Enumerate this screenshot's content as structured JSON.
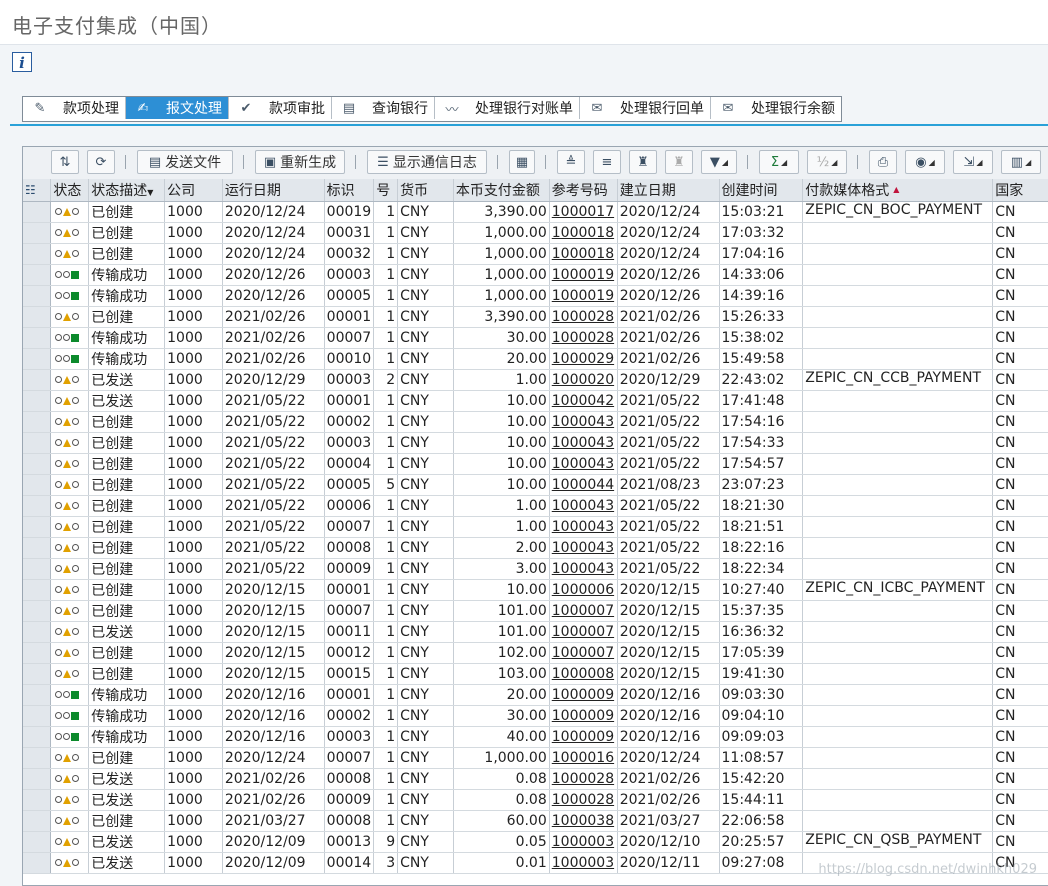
{
  "window": {
    "title": "电子支付集成（中国）"
  },
  "info_button": {
    "label": "i"
  },
  "tabs": [
    {
      "label": "款项处理",
      "icon": "pencil-icon",
      "active": false
    },
    {
      "label": "报文处理",
      "icon": "edit-doc-icon",
      "active": true
    },
    {
      "label": "款项审批",
      "icon": "approve-check-icon",
      "active": false
    },
    {
      "label": "查询银行",
      "icon": "bank-query-icon",
      "active": false
    },
    {
      "label": "处理银行对账单",
      "icon": "chart-line-icon",
      "active": false
    },
    {
      "label": "处理银行回单",
      "icon": "receipt-icon",
      "active": false
    },
    {
      "label": "处理银行余额",
      "icon": "balance-icon",
      "active": false
    }
  ],
  "toolbar": {
    "send_file": "发送文件",
    "regenerate": "重新生成",
    "show_log": "显示通信日志"
  },
  "columns": [
    "状态",
    "状态描述",
    "公司",
    "运行日期",
    "标识",
    "号",
    "货币",
    "本币支付金额",
    "参考号码",
    "建立日期",
    "创建时间",
    "付款媒体格式",
    "国家"
  ],
  "rows": [
    {
      "status": "warn",
      "desc": "已创建",
      "company": "1000",
      "run_date": "2020/12/24",
      "id": "00019",
      "no": "1",
      "currency": "CNY",
      "amount": "3,390.00",
      "ref": "1000017",
      "created_date": "2020/12/24",
      "created_time": "15:03:21",
      "format": "ZEPIC_CN_BOC_PAYMENT",
      "country": "CN"
    },
    {
      "status": "warn",
      "desc": "已创建",
      "company": "1000",
      "run_date": "2020/12/24",
      "id": "00031",
      "no": "1",
      "currency": "CNY",
      "amount": "1,000.00",
      "ref": "1000018",
      "created_date": "2020/12/24",
      "created_time": "17:03:32",
      "format": "",
      "country": "CN"
    },
    {
      "status": "warn",
      "desc": "已创建",
      "company": "1000",
      "run_date": "2020/12/24",
      "id": "00032",
      "no": "1",
      "currency": "CNY",
      "amount": "1,000.00",
      "ref": "1000018",
      "created_date": "2020/12/24",
      "created_time": "17:04:16",
      "format": "",
      "country": "CN"
    },
    {
      "status": "ok",
      "desc": "传输成功",
      "company": "1000",
      "run_date": "2020/12/26",
      "id": "00003",
      "no": "1",
      "currency": "CNY",
      "amount": "1,000.00",
      "ref": "1000019",
      "created_date": "2020/12/26",
      "created_time": "14:33:06",
      "format": "",
      "country": "CN"
    },
    {
      "status": "ok",
      "desc": "传输成功",
      "company": "1000",
      "run_date": "2020/12/26",
      "id": "00005",
      "no": "1",
      "currency": "CNY",
      "amount": "1,000.00",
      "ref": "1000019",
      "created_date": "2020/12/26",
      "created_time": "14:39:16",
      "format": "",
      "country": "CN"
    },
    {
      "status": "warn",
      "desc": "已创建",
      "company": "1000",
      "run_date": "2021/02/26",
      "id": "00001",
      "no": "1",
      "currency": "CNY",
      "amount": "3,390.00",
      "ref": "1000028",
      "created_date": "2021/02/26",
      "created_time": "15:26:33",
      "format": "",
      "country": "CN"
    },
    {
      "status": "ok",
      "desc": "传输成功",
      "company": "1000",
      "run_date": "2021/02/26",
      "id": "00007",
      "no": "1",
      "currency": "CNY",
      "amount": "30.00",
      "ref": "1000028",
      "created_date": "2021/02/26",
      "created_time": "15:38:02",
      "format": "",
      "country": "CN"
    },
    {
      "status": "ok",
      "desc": "传输成功",
      "company": "1000",
      "run_date": "2021/02/26",
      "id": "00010",
      "no": "1",
      "currency": "CNY",
      "amount": "20.00",
      "ref": "1000029",
      "created_date": "2021/02/26",
      "created_time": "15:49:58",
      "format": "",
      "country": "CN"
    },
    {
      "status": "warn",
      "desc": "已发送",
      "company": "1000",
      "run_date": "2020/12/29",
      "id": "00003",
      "no": "2",
      "currency": "CNY",
      "amount": "1.00",
      "ref": "1000020",
      "created_date": "2020/12/29",
      "created_time": "22:43:02",
      "format": "ZEPIC_CN_CCB_PAYMENT",
      "country": "CN"
    },
    {
      "status": "warn",
      "desc": "已发送",
      "company": "1000",
      "run_date": "2021/05/22",
      "id": "00001",
      "no": "1",
      "currency": "CNY",
      "amount": "10.00",
      "ref": "1000042",
      "created_date": "2021/05/22",
      "created_time": "17:41:48",
      "format": "",
      "country": "CN"
    },
    {
      "status": "warn",
      "desc": "已创建",
      "company": "1000",
      "run_date": "2021/05/22",
      "id": "00002",
      "no": "1",
      "currency": "CNY",
      "amount": "10.00",
      "ref": "1000043",
      "created_date": "2021/05/22",
      "created_time": "17:54:16",
      "format": "",
      "country": "CN"
    },
    {
      "status": "warn",
      "desc": "已创建",
      "company": "1000",
      "run_date": "2021/05/22",
      "id": "00003",
      "no": "1",
      "currency": "CNY",
      "amount": "10.00",
      "ref": "1000043",
      "created_date": "2021/05/22",
      "created_time": "17:54:33",
      "format": "",
      "country": "CN"
    },
    {
      "status": "warn",
      "desc": "已创建",
      "company": "1000",
      "run_date": "2021/05/22",
      "id": "00004",
      "no": "1",
      "currency": "CNY",
      "amount": "10.00",
      "ref": "1000043",
      "created_date": "2021/05/22",
      "created_time": "17:54:57",
      "format": "",
      "country": "CN"
    },
    {
      "status": "warn",
      "desc": "已创建",
      "company": "1000",
      "run_date": "2021/05/22",
      "id": "00005",
      "no": "5",
      "currency": "CNY",
      "amount": "10.00",
      "ref": "1000044",
      "created_date": "2021/08/23",
      "created_time": "23:07:23",
      "format": "",
      "country": "CN"
    },
    {
      "status": "warn",
      "desc": "已创建",
      "company": "1000",
      "run_date": "2021/05/22",
      "id": "00006",
      "no": "1",
      "currency": "CNY",
      "amount": "1.00",
      "ref": "1000043",
      "created_date": "2021/05/22",
      "created_time": "18:21:30",
      "format": "",
      "country": "CN"
    },
    {
      "status": "warn",
      "desc": "已创建",
      "company": "1000",
      "run_date": "2021/05/22",
      "id": "00007",
      "no": "1",
      "currency": "CNY",
      "amount": "1.00",
      "ref": "1000043",
      "created_date": "2021/05/22",
      "created_time": "18:21:51",
      "format": "",
      "country": "CN"
    },
    {
      "status": "warn",
      "desc": "已创建",
      "company": "1000",
      "run_date": "2021/05/22",
      "id": "00008",
      "no": "1",
      "currency": "CNY",
      "amount": "2.00",
      "ref": "1000043",
      "created_date": "2021/05/22",
      "created_time": "18:22:16",
      "format": "",
      "country": "CN"
    },
    {
      "status": "warn",
      "desc": "已创建",
      "company": "1000",
      "run_date": "2021/05/22",
      "id": "00009",
      "no": "1",
      "currency": "CNY",
      "amount": "3.00",
      "ref": "1000043",
      "created_date": "2021/05/22",
      "created_time": "18:22:34",
      "format": "",
      "country": "CN"
    },
    {
      "status": "warn",
      "desc": "已创建",
      "company": "1000",
      "run_date": "2020/12/15",
      "id": "00001",
      "no": "1",
      "currency": "CNY",
      "amount": "10.00",
      "ref": "1000006",
      "created_date": "2020/12/15",
      "created_time": "10:27:40",
      "format": "ZEPIC_CN_ICBC_PAYMENT",
      "country": "CN"
    },
    {
      "status": "warn",
      "desc": "已创建",
      "company": "1000",
      "run_date": "2020/12/15",
      "id": "00007",
      "no": "1",
      "currency": "CNY",
      "amount": "101.00",
      "ref": "1000007",
      "created_date": "2020/12/15",
      "created_time": "15:37:35",
      "format": "",
      "country": "CN"
    },
    {
      "status": "warn",
      "desc": "已发送",
      "company": "1000",
      "run_date": "2020/12/15",
      "id": "00011",
      "no": "1",
      "currency": "CNY",
      "amount": "101.00",
      "ref": "1000007",
      "created_date": "2020/12/15",
      "created_time": "16:36:32",
      "format": "",
      "country": "CN"
    },
    {
      "status": "warn",
      "desc": "已创建",
      "company": "1000",
      "run_date": "2020/12/15",
      "id": "00012",
      "no": "1",
      "currency": "CNY",
      "amount": "102.00",
      "ref": "1000007",
      "created_date": "2020/12/15",
      "created_time": "17:05:39",
      "format": "",
      "country": "CN"
    },
    {
      "status": "warn",
      "desc": "已创建",
      "company": "1000",
      "run_date": "2020/12/15",
      "id": "00015",
      "no": "1",
      "currency": "CNY",
      "amount": "103.00",
      "ref": "1000008",
      "created_date": "2020/12/15",
      "created_time": "19:41:30",
      "format": "",
      "country": "CN"
    },
    {
      "status": "ok",
      "desc": "传输成功",
      "company": "1000",
      "run_date": "2020/12/16",
      "id": "00001",
      "no": "1",
      "currency": "CNY",
      "amount": "20.00",
      "ref": "1000009",
      "created_date": "2020/12/16",
      "created_time": "09:03:30",
      "format": "",
      "country": "CN"
    },
    {
      "status": "ok",
      "desc": "传输成功",
      "company": "1000",
      "run_date": "2020/12/16",
      "id": "00002",
      "no": "1",
      "currency": "CNY",
      "amount": "30.00",
      "ref": "1000009",
      "created_date": "2020/12/16",
      "created_time": "09:04:10",
      "format": "",
      "country": "CN"
    },
    {
      "status": "ok",
      "desc": "传输成功",
      "company": "1000",
      "run_date": "2020/12/16",
      "id": "00003",
      "no": "1",
      "currency": "CNY",
      "amount": "40.00",
      "ref": "1000009",
      "created_date": "2020/12/16",
      "created_time": "09:09:03",
      "format": "",
      "country": "CN"
    },
    {
      "status": "warn",
      "desc": "已创建",
      "company": "1000",
      "run_date": "2020/12/24",
      "id": "00007",
      "no": "1",
      "currency": "CNY",
      "amount": "1,000.00",
      "ref": "1000016",
      "created_date": "2020/12/24",
      "created_time": "11:08:57",
      "format": "",
      "country": "CN"
    },
    {
      "status": "warn",
      "desc": "已发送",
      "company": "1000",
      "run_date": "2021/02/26",
      "id": "00008",
      "no": "1",
      "currency": "CNY",
      "amount": "0.08",
      "ref": "1000028",
      "created_date": "2021/02/26",
      "created_time": "15:42:20",
      "format": "",
      "country": "CN"
    },
    {
      "status": "warn",
      "desc": "已发送",
      "company": "1000",
      "run_date": "2021/02/26",
      "id": "00009",
      "no": "1",
      "currency": "CNY",
      "amount": "0.08",
      "ref": "1000028",
      "created_date": "2021/02/26",
      "created_time": "15:44:11",
      "format": "",
      "country": "CN"
    },
    {
      "status": "warn",
      "desc": "已创建",
      "company": "1000",
      "run_date": "2021/03/27",
      "id": "00008",
      "no": "1",
      "currency": "CNY",
      "amount": "60.00",
      "ref": "1000038",
      "created_date": "2021/03/27",
      "created_time": "22:06:58",
      "format": "",
      "country": "CN"
    },
    {
      "status": "warn",
      "desc": "已发送",
      "company": "1000",
      "run_date": "2020/12/09",
      "id": "00013",
      "no": "9",
      "currency": "CNY",
      "amount": "0.05",
      "ref": "1000003",
      "created_date": "2020/12/10",
      "created_time": "20:25:57",
      "format": "ZEPIC_CN_QSB_PAYMENT",
      "country": "CN"
    },
    {
      "status": "warn",
      "desc": "已发送",
      "company": "1000",
      "run_date": "2020/12/09",
      "id": "00014",
      "no": "3",
      "currency": "CNY",
      "amount": "0.01",
      "ref": "1000003",
      "created_date": "2020/12/11",
      "created_time": "09:27:08",
      "format": "",
      "country": "CN"
    }
  ],
  "watermark": "https://blog.csdn.net/dwinhkh029",
  "colors": {
    "accent": "#2d8fd5",
    "ok": "#0c8a2c",
    "warn": "#e1a100",
    "sort": "#c0143c"
  }
}
